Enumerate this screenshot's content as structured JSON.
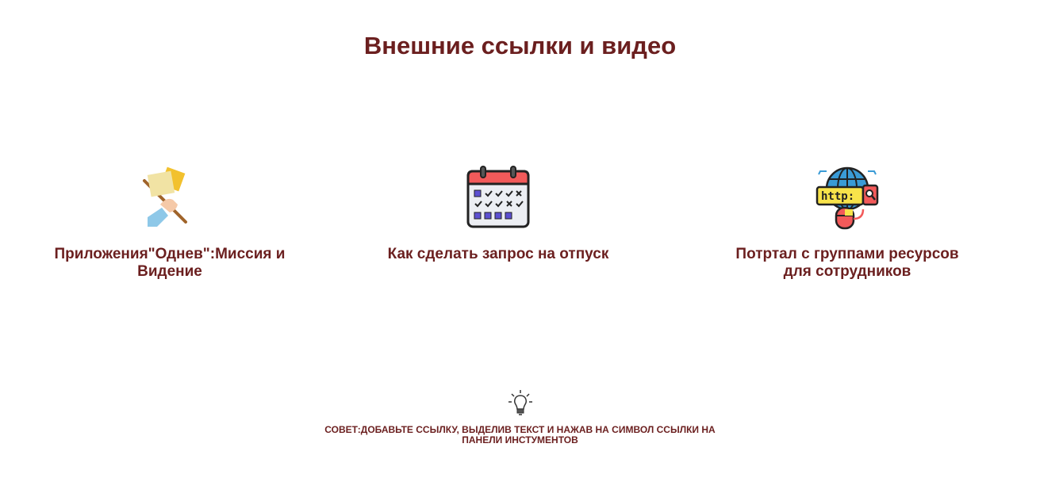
{
  "page": {
    "title": "Внешние ссылки и видео"
  },
  "links": [
    {
      "label": "Приложения\"Однев\":Миссия и Видение",
      "icon": "flag-hand-icon"
    },
    {
      "label": "Как сделать запрос на отпуск",
      "icon": "calendar-icon"
    },
    {
      "label": "Потртал с группами ресурсов для сотрудников",
      "icon": "globe-http-icon"
    }
  ],
  "tip": {
    "icon": "lightbulb-icon",
    "text": "СОВЕТ:ДОБАВЬТЕ ССЫЛКУ, ВЫДЕЛИВ ТЕКСТ И НАЖАВ НА СИМВОЛ ССЫЛКИ НА ПАНЕЛИ ИНСТУМЕНТОВ"
  },
  "colors": {
    "text": "#6b1f1f",
    "background": "#ffffff"
  }
}
